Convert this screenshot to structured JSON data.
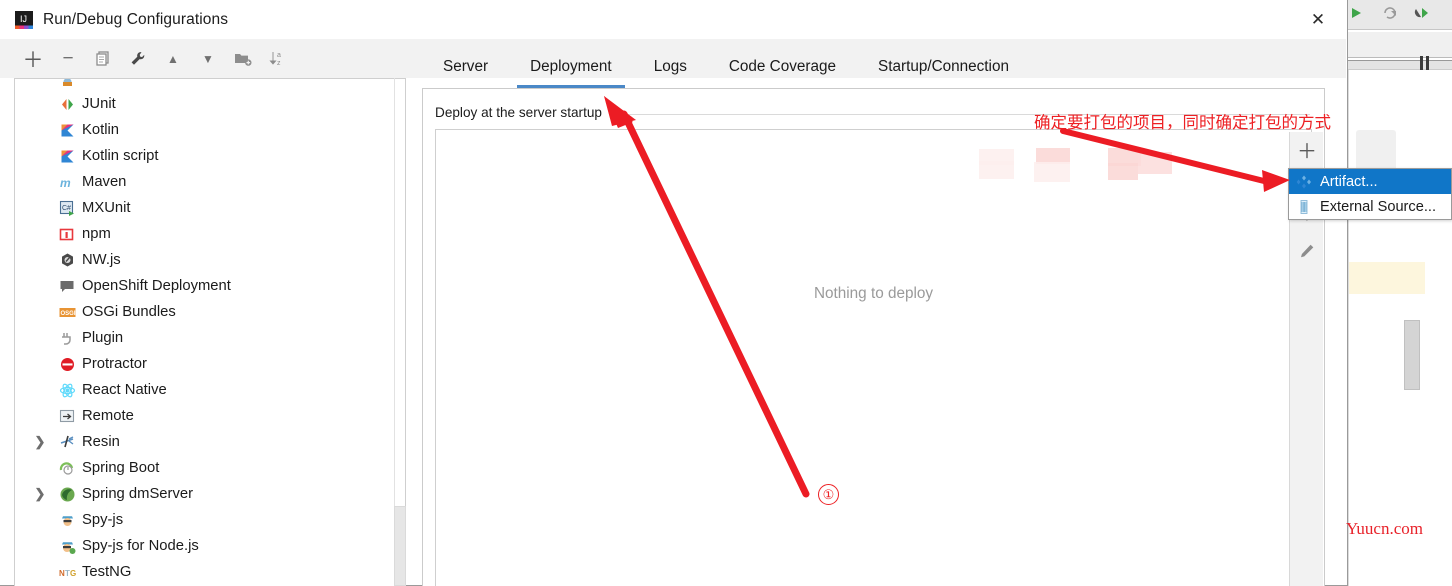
{
  "window": {
    "title": "Run/Debug Configurations",
    "icon": "intellij-idea-icon",
    "close_label": "✕"
  },
  "toolbar": {
    "buttons": [
      {
        "name": "add-button",
        "glyph": "＋"
      },
      {
        "name": "remove-button",
        "glyph": "−"
      },
      {
        "name": "copy-button",
        "glyph": "❐"
      },
      {
        "name": "edit-templates-button",
        "glyph": "🔧"
      },
      {
        "name": "move-up-button",
        "glyph": "▲"
      },
      {
        "name": "move-down-button",
        "glyph": "▼"
      },
      {
        "name": "new-folder-button",
        "glyph": "🗀"
      },
      {
        "name": "sort-button",
        "glyph": "↧"
      }
    ]
  },
  "tree": {
    "items": [
      {
        "label": "",
        "icon": "cut-off-icon",
        "expandable": false,
        "partial": true
      },
      {
        "label": "JUnit",
        "icon": "junit-icon",
        "expandable": false
      },
      {
        "label": "Kotlin",
        "icon": "kotlin-icon",
        "expandable": false
      },
      {
        "label": "Kotlin script",
        "icon": "kotlin-icon",
        "expandable": false
      },
      {
        "label": "Maven",
        "icon": "maven-icon",
        "expandable": false
      },
      {
        "label": "MXUnit",
        "icon": "mxunit-icon",
        "expandable": false
      },
      {
        "label": "npm",
        "icon": "npm-icon",
        "expandable": false
      },
      {
        "label": "NW.js",
        "icon": "nwjs-icon",
        "expandable": false
      },
      {
        "label": "OpenShift Deployment",
        "icon": "openshift-icon",
        "expandable": false
      },
      {
        "label": "OSGi Bundles",
        "icon": "osgi-icon",
        "expandable": false
      },
      {
        "label": "Plugin",
        "icon": "plugin-icon",
        "expandable": false
      },
      {
        "label": "Protractor",
        "icon": "protractor-icon",
        "expandable": false
      },
      {
        "label": "React Native",
        "icon": "react-native-icon",
        "expandable": false
      },
      {
        "label": "Remote",
        "icon": "remote-icon",
        "expandable": false
      },
      {
        "label": "Resin",
        "icon": "resin-icon",
        "expandable": true
      },
      {
        "label": "Spring Boot",
        "icon": "spring-boot-icon",
        "expandable": false
      },
      {
        "label": "Spring dmServer",
        "icon": "spring-dmserver-icon",
        "expandable": true
      },
      {
        "label": "Spy-js",
        "icon": "spy-js-icon",
        "expandable": false
      },
      {
        "label": "Spy-js for Node.js",
        "icon": "spy-js-node-icon",
        "expandable": false
      },
      {
        "label": "TestNG",
        "icon": "testng-icon",
        "expandable": false
      }
    ]
  },
  "tabs": [
    {
      "label": "Server",
      "active": false
    },
    {
      "label": "Deployment",
      "active": true
    },
    {
      "label": "Logs",
      "active": false
    },
    {
      "label": "Code Coverage",
      "active": false
    },
    {
      "label": "Startup/Connection",
      "active": false
    }
  ],
  "deployment": {
    "section_label": "Deploy at the server startup",
    "empty_message": "Nothing to deploy",
    "side_buttons": [
      {
        "name": "add-artifact-button",
        "glyph": "＋"
      },
      {
        "name": "move-up-button",
        "glyph": "▲"
      },
      {
        "name": "move-down-button",
        "glyph": "▼"
      },
      {
        "name": "edit-button",
        "glyph": "✎"
      }
    ]
  },
  "popup_menu": {
    "items": [
      {
        "label": "Artifact...",
        "icon": "artifact-icon",
        "selected": true
      },
      {
        "label": "External Source...",
        "icon": "external-source-icon",
        "selected": false
      }
    ]
  },
  "annotations": {
    "chinese_note": "确定要打包的项目，同时确定打包的方式",
    "step_marker": "①",
    "watermark": "Yuucn.com"
  },
  "colors": {
    "accent_blue": "#4a88c7",
    "selection_blue": "#1076c8",
    "annotation_red": "#ed2024",
    "watermark_red": "#e8222a",
    "empty_gray": "#9a9a9a"
  }
}
